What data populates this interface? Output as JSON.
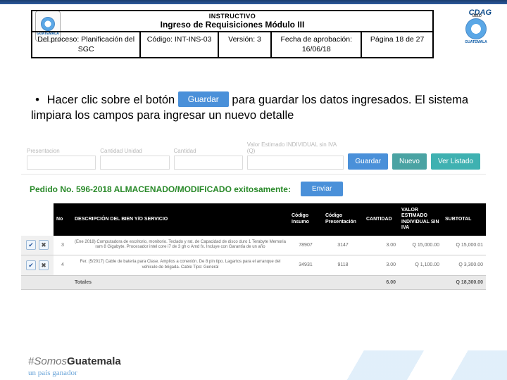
{
  "header": {
    "instructivo": "INSTRUCTIVO",
    "subtitle": "Ingreso de Requisiciones Módulo III",
    "proceso_label": "Del proceso: Planificación del SGC",
    "codigo": "Código: INT-INS-03",
    "version": "Versión: 3",
    "fecha": "Fecha de aprobación: 16/06/18",
    "pagina": "Página 18 de 27",
    "brand": "CDAG",
    "country": "GUATEMALA"
  },
  "bullet": {
    "pre": "Hacer clic sobre el botón ",
    "chip": "Guardar",
    "post": " para guardar los datos ingresados. El sistema limpiara los campos para ingresar un nuevo detalle"
  },
  "form": {
    "labels": {
      "presentacion": "Presentacion",
      "cantidad_unidad": "Cantidad Unidad",
      "cantidad": "Cantidad",
      "valor": "Valor Estimado INDIVIDUAL sin IVA (Q)"
    },
    "buttons": {
      "guardar": "Guardar",
      "nuevo": "Nuevo",
      "ver": "Ver Listado"
    }
  },
  "success": {
    "text": "Pedido No. 596-2018 ALMACENADO/MODIFICADO exitosamente:",
    "enviar": "Enviar"
  },
  "table": {
    "headers": {
      "no": "No",
      "desc": "DESCRIPCIÓN DEL BIEN Y/O SERVICIO",
      "insumo": "Código Insumo",
      "present": "Código Presentación",
      "cant": "CANTIDAD",
      "valor": "VALOR ESTIMADO INDIVIDUAL SIN IVA",
      "subtotal": "SUBTOTAL"
    },
    "rows": [
      {
        "no": "3",
        "desc": "(Ene 2018) Computadora de escritorio, monitorio. Teclado y rat. de Capacidad de disco duro 1 Terabyte Memoria ram 8 Gigabyte. Procesador intel core i7 de 3 gh o Amd fx. Incluye con Garantía de un año",
        "insumo": "78907",
        "present": "3147",
        "cant": "3.00",
        "valor": "Q 15,000.00",
        "subtotal": "Q 15,000.01"
      },
      {
        "no": "4",
        "desc": "Fer. (5/2017) Cable de bateria para Clase. Amplios a conexión. De 8 pin tipo. Lagartos para el arranque del vehiculo de brigada. Cable Tipo: General",
        "insumo": "34931",
        "present": "9118",
        "cant": "3.00",
        "valor": "Q 1,100.00",
        "subtotal": "Q 3,300.00"
      }
    ],
    "total_label": "Totales",
    "total_cant": "6.00",
    "total_sub": "Q 18,300.00"
  },
  "footer": {
    "hash_pre": "#Somos",
    "hash_bold": "Guatemala",
    "sub": "un país ganador"
  }
}
